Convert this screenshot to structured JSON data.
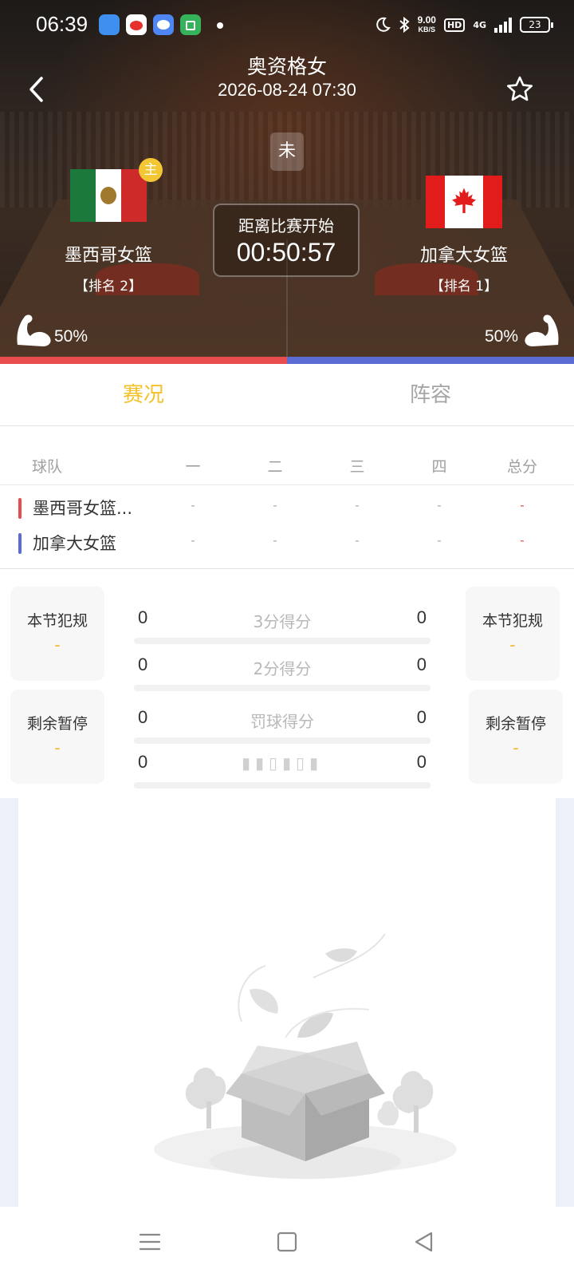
{
  "status_bar": {
    "time": "06:39",
    "speed_value": "9.00",
    "speed_unit": "KB/S",
    "hd": "HD",
    "network": "4G",
    "battery": "23"
  },
  "header": {
    "title": "奥资格女",
    "datetime": "2026-08-24 07:30",
    "status_badge": "未",
    "countdown_label": "距离比赛开始",
    "countdown_value": "00:50:57",
    "home_badge": "主"
  },
  "home_team": {
    "name": "墨西哥女篮",
    "rank": "【排名 2】",
    "strength_pct": "50%",
    "strength_value": 0.5,
    "flag_colors": [
      "#1b7a3b",
      "#ffffff",
      "#ce2a2a"
    ]
  },
  "away_team": {
    "name": "加拿大女篮",
    "rank": "【排名 1】",
    "strength_pct": "50%",
    "strength_value": 0.5,
    "flag_colors": [
      "#e21b1b",
      "#ffffff",
      "#e21b1b"
    ]
  },
  "colors": {
    "accent": "#f3c12a",
    "home_bar": "#e84c4c",
    "away_bar": "#5b6bd4"
  },
  "tabs": [
    {
      "label": "赛况",
      "active": true
    },
    {
      "label": "阵容",
      "active": false
    }
  ],
  "score_table": {
    "headers": [
      "球队",
      "一",
      "二",
      "三",
      "四",
      "总分"
    ],
    "rows": [
      {
        "team": "墨西哥女篮...",
        "q1": "-",
        "q2": "-",
        "q3": "-",
        "q4": "-",
        "total": "-"
      },
      {
        "team": "加拿大女篮",
        "q1": "-",
        "q2": "-",
        "q3": "-",
        "q4": "-",
        "total": "-"
      }
    ]
  },
  "side_stats": {
    "fouls_label": "本节犯规",
    "fouls_home": "-",
    "fouls_away": "-",
    "timeouts_label": "剩余暂停",
    "timeouts_home": "-",
    "timeouts_away": "-"
  },
  "stats": [
    {
      "label": "3分得分",
      "home": "0",
      "away": "0"
    },
    {
      "label": "2分得分",
      "home": "0",
      "away": "0"
    },
    {
      "label": "罚球得分",
      "home": "0",
      "away": "0"
    },
    {
      "label": "",
      "home": "0",
      "away": "0"
    }
  ],
  "icons": {
    "back": "chevron-left-icon",
    "favorite": "star-outline-icon",
    "strength": "flexed-arm-icon",
    "empty": "empty-box-icon",
    "sys_menu": "menu-icon",
    "sys_home": "square-icon",
    "sys_back": "triangle-back-icon"
  }
}
